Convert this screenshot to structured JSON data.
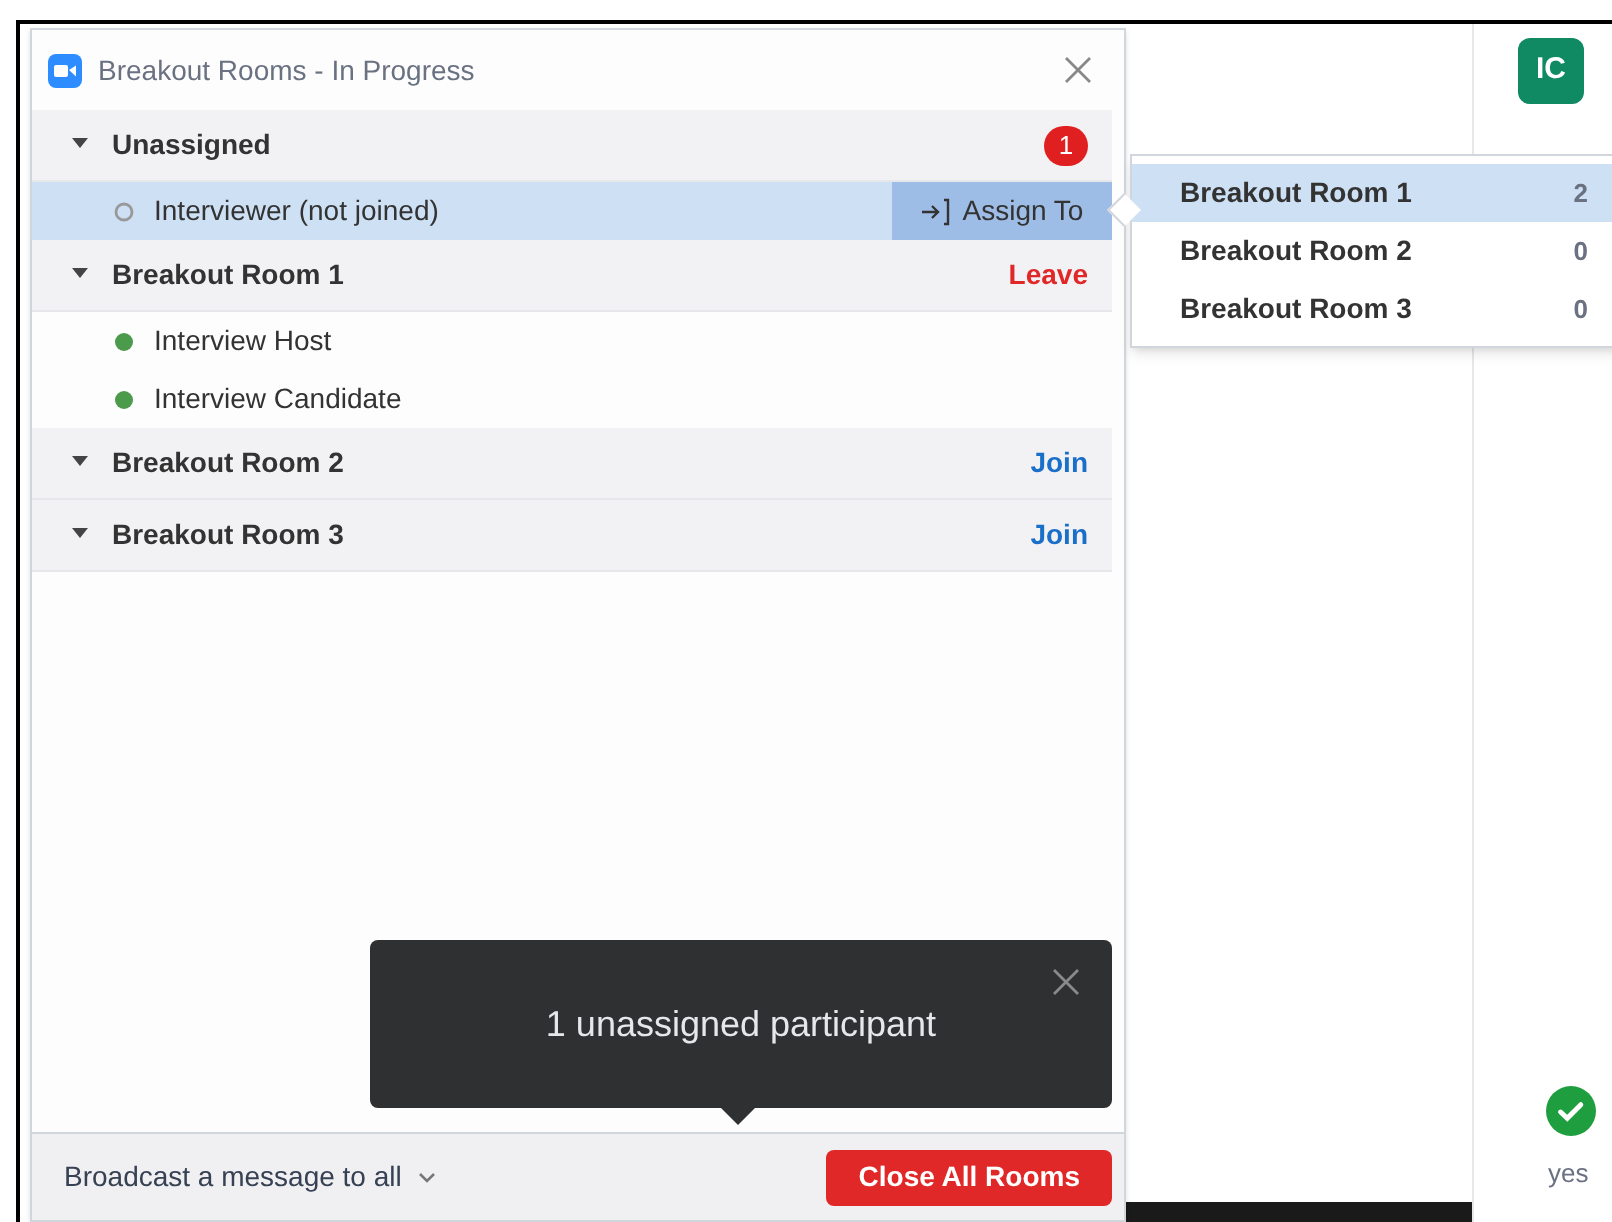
{
  "window": {
    "title": "Breakout Rooms - In Progress"
  },
  "groups": [
    {
      "name": "Unassigned",
      "expanded": true,
      "badge": "1",
      "participants": [
        {
          "name": "Interviewer (not joined)",
          "joined": false,
          "selected": true,
          "action": "Assign To"
        }
      ]
    },
    {
      "name": "Breakout Room 1",
      "expanded": true,
      "action": {
        "label": "Leave",
        "kind": "leave"
      },
      "participants": [
        {
          "name": "Interview Host",
          "joined": true,
          "selected": false
        },
        {
          "name": "Interview Candidate",
          "joined": true,
          "selected": false
        }
      ]
    },
    {
      "name": "Breakout Room 2",
      "expanded": true,
      "action": {
        "label": "Join",
        "kind": "join"
      }
    },
    {
      "name": "Breakout Room 3",
      "expanded": true,
      "action": {
        "label": "Join",
        "kind": "join"
      }
    }
  ],
  "assign_menu": [
    {
      "name": "Breakout Room 1",
      "count": "2",
      "selected": true
    },
    {
      "name": "Breakout Room 2",
      "count": "0",
      "selected": false
    },
    {
      "name": "Breakout Room 3",
      "count": "0",
      "selected": false
    }
  ],
  "footer": {
    "broadcast": "Broadcast a message to all",
    "close_button": "Close All Rooms"
  },
  "toast": {
    "message": "1 unassigned participant"
  },
  "side_panel": {
    "avatar": "IC",
    "status": "yes"
  }
}
